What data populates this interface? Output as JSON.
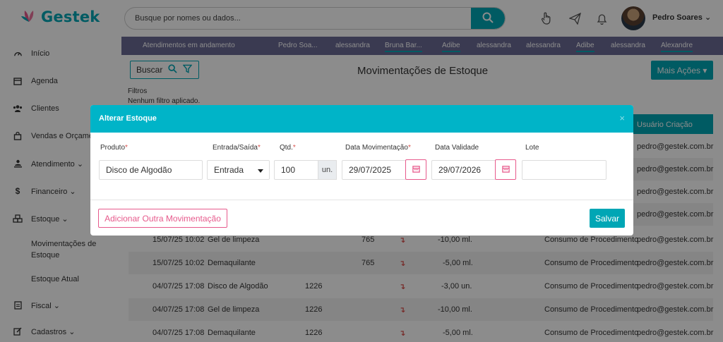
{
  "app": {
    "name": "Gestek"
  },
  "colors": {
    "accent": "#00a6b5",
    "pink": "#e75a8c",
    "tabs_bg": "#6a6a94",
    "danger": "#d9534f"
  },
  "sidebar": {
    "items": [
      {
        "label": "Início",
        "icon": "gauge-icon"
      },
      {
        "label": "Agenda",
        "icon": "calendar-icon"
      },
      {
        "label": "Clientes",
        "icon": "users-icon"
      },
      {
        "label": "Vendas e Orçamen",
        "icon": "bag-icon"
      },
      {
        "label": "Atendimento ⌄",
        "icon": "service-icon"
      },
      {
        "label": "Financeiro ⌄",
        "icon": "dollar-icon"
      },
      {
        "label": "Estoque ⌄",
        "icon": "boxes-icon"
      }
    ],
    "sub_items": [
      "Movimentações de Estoque",
      "Estoque Atual"
    ],
    "bottom_items": [
      {
        "label": "Fiscal ⌄",
        "icon": "document-icon"
      },
      {
        "label": "Cadastros ⌄",
        "icon": "edit-icon"
      }
    ]
  },
  "header": {
    "search_placeholder": "Busque por nomes ou dados...",
    "user_name": "Pedro Soares ⌄"
  },
  "tabs": [
    "Atendimentos em andamento",
    "Pedro Soa...",
    "alessandra",
    "Bruna Bar...",
    "Adibe",
    "alessandra",
    "alessandra",
    "Adibe",
    "alessandra",
    "Alexandre"
  ],
  "toolbar": {
    "buscar_label": "Buscar",
    "page_title": "Movimentações de Estoque",
    "mais_acoes_label": "Mais Ações ▾",
    "filtros_label": "Filtros",
    "filtros_status": "Nenhum filtro aplicado."
  },
  "table": {
    "header_visible": "Usuário Criação",
    "top_emails": [
      "pedro@gestek.com.br",
      "pedro@gestek.com.br",
      "pedro@gestek.com.br",
      "pedro@gestek.com.br"
    ],
    "rows": [
      {
        "date": "15/07/25 10:02",
        "product": "Gel de limpeza",
        "lot": "",
        "code": "765",
        "qty": "-10,00 ml.",
        "reason": "Consumo de Procedimento",
        "user": "pedro@gestek.com.br"
      },
      {
        "date": "15/07/25 10:02",
        "product": "Demaquilante",
        "lot": "",
        "code": "765",
        "qty": "-5,00 ml.",
        "reason": "Consumo de Procedimento",
        "user": "pedro@gestek.com.br"
      },
      {
        "date": "04/07/25 17:08",
        "product": "Disco de Algodão",
        "lot": "1226",
        "code": "",
        "qty": "-3,00 un.",
        "reason": "Consumo de Procedimento",
        "user": "pedro@gestek.com.br"
      },
      {
        "date": "04/07/25 17:08",
        "product": "Gel de limpeza",
        "lot": "1226",
        "code": "",
        "qty": "-10,00 ml.",
        "reason": "Consumo de Procedimento",
        "user": "pedro@gestek.com.br"
      },
      {
        "date": "04/07/25 17:08",
        "product": "Demaquilante",
        "lot": "1226",
        "code": "",
        "qty": "-5,00 ml.",
        "reason": "Consumo de Procedimento",
        "user": "pedro@gestek.com.br"
      }
    ],
    "arrow": "↴"
  },
  "modal": {
    "title": "Alterar Estoque",
    "close": "×",
    "labels": {
      "produto": "Produto",
      "entrada_saida": "Entrada/Saída",
      "qtd": "Qtd.",
      "data_mov": "Data Movimentação",
      "data_val": "Data Validade",
      "lote": "Lote"
    },
    "required_mark": "*",
    "values": {
      "produto": "Disco de Algodão",
      "entrada_saida": "Entrada",
      "qtd": "100",
      "unit": "un.",
      "data_mov": "29/07/2025",
      "data_val": "29/07/2026",
      "lote": ""
    },
    "add_button": "Adicionar Outra Movimentação",
    "save_button": "Salvar"
  }
}
